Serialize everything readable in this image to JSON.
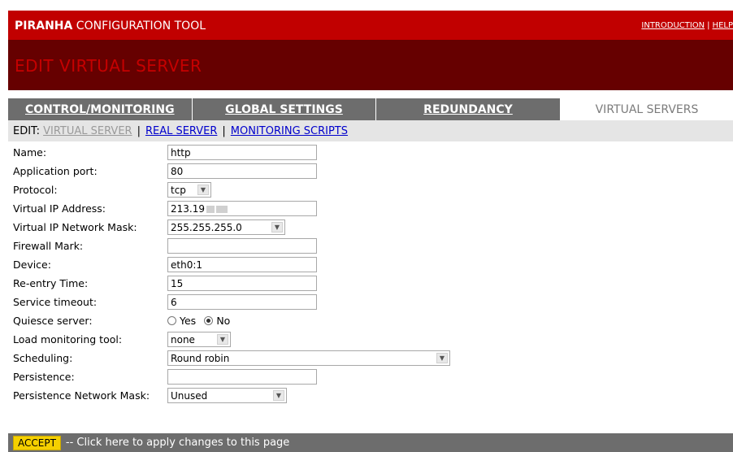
{
  "header": {
    "brand_bold": "PIRANHA",
    "brand_rest": " CONFIGURATION TOOL",
    "links": [
      "INTRODUCTION",
      "HELP"
    ]
  },
  "banner": {
    "title": "EDIT VIRTUAL SERVER"
  },
  "tabs": [
    {
      "label": "CONTROL/MONITORING"
    },
    {
      "label": "GLOBAL SETTINGS"
    },
    {
      "label": "REDUNDANCY"
    },
    {
      "label": "VIRTUAL SERVERS"
    }
  ],
  "subnav": {
    "prefix": "EDIT:",
    "current": "VIRTUAL SERVER",
    "links": [
      "REAL SERVER",
      "MONITORING SCRIPTS"
    ]
  },
  "form": {
    "name": {
      "label": "Name:",
      "value": "http"
    },
    "app_port": {
      "label": "Application port:",
      "value": "80"
    },
    "protocol": {
      "label": "Protocol:",
      "value": "tcp"
    },
    "vip": {
      "label": "Virtual IP Address:",
      "value": "213.19"
    },
    "vip_mask": {
      "label": "Virtual IP Network Mask:",
      "value": "255.255.255.0"
    },
    "firewall_mark": {
      "label": "Firewall Mark:",
      "value": ""
    },
    "device": {
      "label": "Device:",
      "value": "eth0:1"
    },
    "reentry": {
      "label": "Re-entry Time:",
      "value": "15"
    },
    "timeout": {
      "label": "Service timeout:",
      "value": "6"
    },
    "quiesce": {
      "label": "Quiesce server:",
      "yes": "Yes",
      "no": "No",
      "selected": "No"
    },
    "load_tool": {
      "label": "Load monitoring tool:",
      "value": "none"
    },
    "scheduling": {
      "label": "Scheduling:",
      "value": "Round robin"
    },
    "persistence": {
      "label": "Persistence:",
      "value": ""
    },
    "persistence_mask": {
      "label": "Persistence Network Mask:",
      "value": "Unused"
    }
  },
  "footer": {
    "button": "ACCEPT",
    "text": "-- Click here to apply changes to this page"
  },
  "colors": {
    "topbar": "#c10000",
    "banner": "#660000",
    "tab_bg": "#6d6d6d",
    "accept": "#f5d000",
    "link": "#0000cc"
  }
}
